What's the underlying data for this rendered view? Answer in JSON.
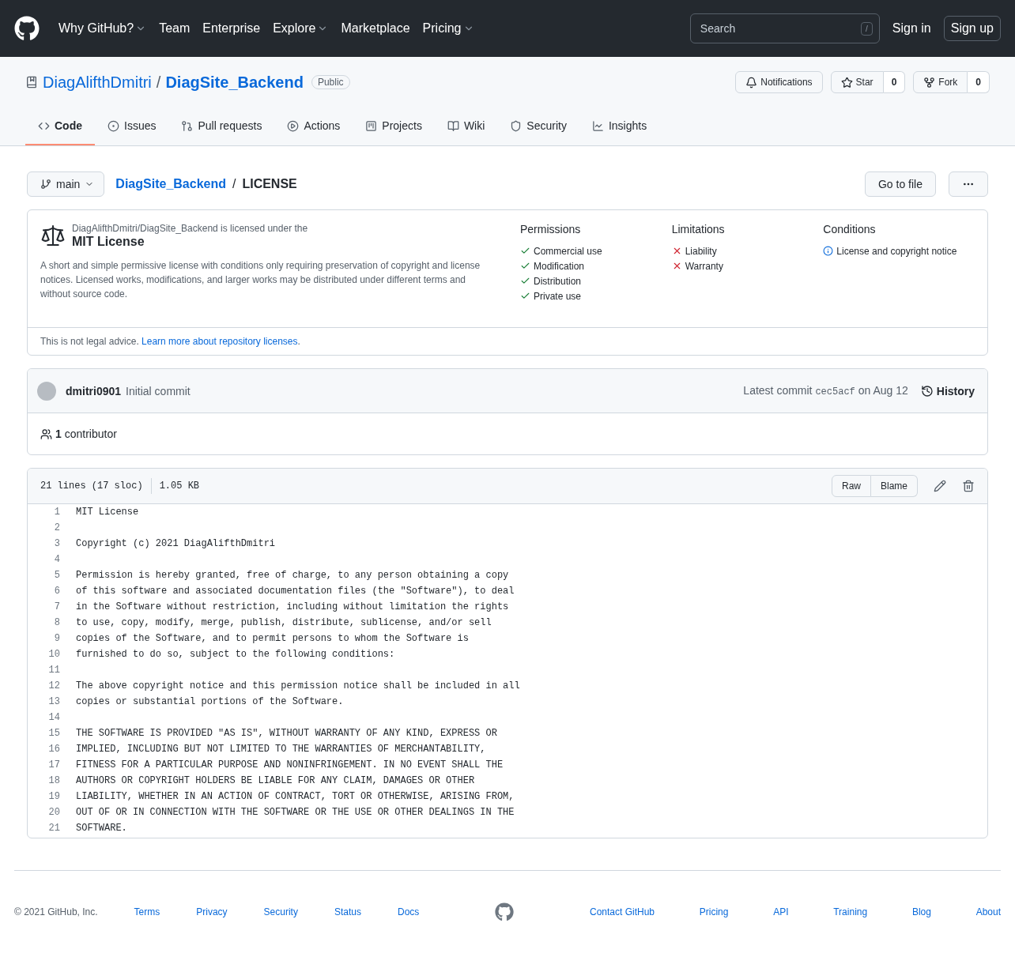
{
  "header": {
    "nav": [
      {
        "label": "Why GitHub?",
        "dropdown": true
      },
      {
        "label": "Team",
        "dropdown": false
      },
      {
        "label": "Enterprise",
        "dropdown": false
      },
      {
        "label": "Explore",
        "dropdown": true
      },
      {
        "label": "Marketplace",
        "dropdown": false
      },
      {
        "label": "Pricing",
        "dropdown": true
      }
    ],
    "search": {
      "placeholder": "Search",
      "key": "/"
    },
    "sign_in": "Sign in",
    "sign_up": "Sign up"
  },
  "repo": {
    "owner": "DiagAlifthDmitri",
    "separator": "/",
    "name": "DiagSite_Backend",
    "visibility": "Public",
    "notifications": "Notifications",
    "star": {
      "label": "Star",
      "count": "0"
    },
    "fork": {
      "label": "Fork",
      "count": "0"
    }
  },
  "tabs": [
    {
      "label": "Code",
      "kind": "code",
      "selected": true
    },
    {
      "label": "Issues",
      "kind": "issues",
      "selected": false
    },
    {
      "label": "Pull requests",
      "kind": "pulls",
      "selected": false
    },
    {
      "label": "Actions",
      "kind": "actions",
      "selected": false
    },
    {
      "label": "Projects",
      "kind": "projects",
      "selected": false
    },
    {
      "label": "Wiki",
      "kind": "wiki",
      "selected": false
    },
    {
      "label": "Security",
      "kind": "security",
      "selected": false
    },
    {
      "label": "Insights",
      "kind": "insights",
      "selected": false
    }
  ],
  "file_bar": {
    "branch": "main",
    "repo_link": "DiagSite_Backend",
    "separator": "/",
    "file": "LICENSE",
    "go_to_file": "Go to file"
  },
  "license": {
    "intro": "DiagAlifthDmitri/DiagSite_Backend is licensed under the",
    "name": "MIT License",
    "description": "A short and simple permissive license with conditions only requiring preservation of copyright and license notices. Licensed works, modifications, and larger works may be distributed under different terms and without source code.",
    "columns": [
      {
        "title": "Permissions",
        "items": [
          {
            "kind": "permission",
            "label": "Commercial use"
          },
          {
            "kind": "permission",
            "label": "Modification"
          },
          {
            "kind": "permission",
            "label": "Distribution"
          },
          {
            "kind": "permission",
            "label": "Private use"
          }
        ]
      },
      {
        "title": "Limitations",
        "items": [
          {
            "kind": "limitation",
            "label": "Liability"
          },
          {
            "kind": "limitation",
            "label": "Warranty"
          }
        ]
      },
      {
        "title": "Conditions",
        "items": [
          {
            "kind": "condition",
            "label": "License and copyright notice"
          }
        ]
      }
    ],
    "disclaimer": {
      "text": "This is not legal advice.",
      "link": "Learn more about repository licenses",
      "suffix": "."
    }
  },
  "commit": {
    "author": "dmitri0901",
    "message": "Initial commit",
    "latest": "Latest commit",
    "sha": "cec5acf",
    "date": "on Aug 12",
    "history": "History",
    "contributors_count": "1",
    "contributors_label": "contributor"
  },
  "file": {
    "lines_info": "21 lines (17 sloc)",
    "size": "1.05 KB",
    "raw": "Raw",
    "blame": "Blame",
    "lines": [
      {
        "number": "1",
        "text": "MIT License"
      },
      {
        "number": "2"
      },
      {
        "number": "3",
        "text": "Copyright (c) 2021 DiagAlifthDmitri"
      },
      {
        "number": "4"
      },
      {
        "number": "5",
        "text": "Permission is hereby granted, free of charge, to any person obtaining a copy"
      },
      {
        "number": "6",
        "text": "of this software and associated documentation files (the \"Software\"), to deal"
      },
      {
        "number": "7",
        "text": "in the Software without restriction, including without limitation the rights"
      },
      {
        "number": "8",
        "text": "to use, copy, modify, merge, publish, distribute, sublicense, and/or sell"
      },
      {
        "number": "9",
        "text": "copies of the Software, and to permit persons to whom the Software is"
      },
      {
        "number": "10",
        "text": "furnished to do so, subject to the following conditions:"
      },
      {
        "number": "11"
      },
      {
        "number": "12",
        "text": "The above copyright notice and this permission notice shall be included in all"
      },
      {
        "number": "13",
        "text": "copies or substantial portions of the Software."
      },
      {
        "number": "14"
      },
      {
        "number": "15",
        "text": "THE SOFTWARE IS PROVIDED \"AS IS\", WITHOUT WARRANTY OF ANY KIND, EXPRESS OR"
      },
      {
        "number": "16",
        "text": "IMPLIED, INCLUDING BUT NOT LIMITED TO THE WARRANTIES OF MERCHANTABILITY,"
      },
      {
        "number": "17",
        "text": "FITNESS FOR A PARTICULAR PURPOSE AND NONINFRINGEMENT. IN NO EVENT SHALL THE"
      },
      {
        "number": "18",
        "text": "AUTHORS OR COPYRIGHT HOLDERS BE LIABLE FOR ANY CLAIM, DAMAGES OR OTHER"
      },
      {
        "number": "19",
        "text": "LIABILITY, WHETHER IN AN ACTION OF CONTRACT, TORT OR OTHERWISE, ARISING FROM,"
      },
      {
        "number": "20",
        "text": "OUT OF OR IN CONNECTION WITH THE SOFTWARE OR THE USE OR OTHER DEALINGS IN THE"
      },
      {
        "number": "21",
        "text": "SOFTWARE."
      }
    ]
  },
  "footer": {
    "copyright": "© 2021 GitHub, Inc.",
    "left_links": [
      "Terms",
      "Privacy",
      "Security",
      "Status",
      "Docs"
    ],
    "right_links": [
      "Contact GitHub",
      "Pricing",
      "API",
      "Training",
      "Blog",
      "About"
    ]
  }
}
